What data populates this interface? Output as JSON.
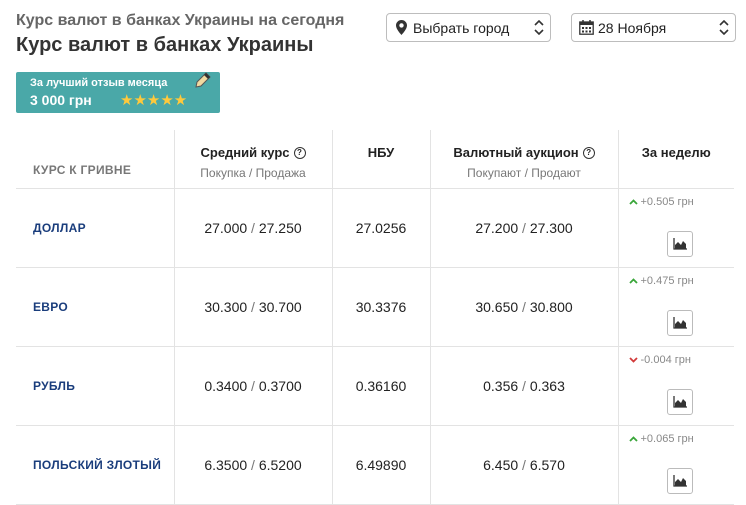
{
  "header": {
    "subtitle": "Курс валют в банках Украины на сегодня",
    "title": "Курс валют в банках Украины"
  },
  "city_select": {
    "value": "Выбрать город",
    "icon": "location-pin-icon"
  },
  "date_select": {
    "value": "28 Ноября",
    "icon": "calendar-icon"
  },
  "promo": {
    "line1": "За лучший отзыв месяца",
    "line2": "3 000 грн",
    "rating": 4.5,
    "stars": "★★★★★"
  },
  "table": {
    "headers": {
      "currency": "КУРС К ГРИВНЕ",
      "average": "Средний курс",
      "average_sub": "Покупка / Продажа",
      "nbu": "НБУ",
      "auction": "Валютный аукцион",
      "auction_sub": "Покупают / Продают",
      "week": "За неделю"
    },
    "rows": [
      {
        "name": "ДОЛЛАР",
        "avg_buy": "27.000",
        "avg_sell": "27.250",
        "nbu": "27.0256",
        "auc_buy": "27.200",
        "auc_sell": "27.300",
        "change": "+0.505 грн",
        "dir": "up"
      },
      {
        "name": "ЕВРО",
        "avg_buy": "30.300",
        "avg_sell": "30.700",
        "nbu": "30.3376",
        "auc_buy": "30.650",
        "auc_sell": "30.800",
        "change": "+0.475 грн",
        "dir": "up"
      },
      {
        "name": "РУБЛЬ",
        "avg_buy": "0.3400",
        "avg_sell": "0.3700",
        "nbu": "0.36160",
        "auc_buy": "0.356",
        "auc_sell": "0.363",
        "change": "-0.004 грн",
        "dir": "down"
      },
      {
        "name": "ПОЛЬСКИЙ ЗЛОТЫЙ",
        "avg_buy": "6.3500",
        "avg_sell": "6.5200",
        "nbu": "6.49890",
        "auc_buy": "6.450",
        "auc_sell": "6.570",
        "change": "+0.065 грн",
        "dir": "up"
      }
    ]
  },
  "colors": {
    "promo_bg": "#4aa8a8",
    "currency_text": "#1a3d7c",
    "up": "#3aa63a",
    "down": "#d23a3a",
    "star": "#ffc93c"
  },
  "separator": "/"
}
